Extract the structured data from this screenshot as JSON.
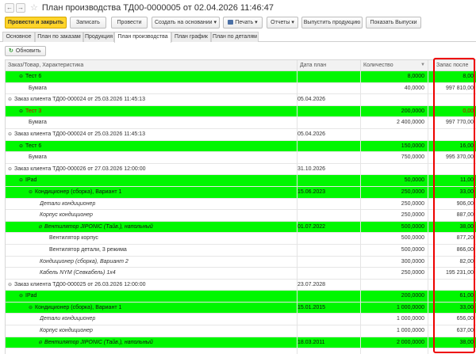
{
  "window": {
    "title": "План производства ТД00-0000005 от 02.04.2026 11:46:47",
    "back_glyph": "←",
    "forward_glyph": "→",
    "favorite_icon": "star-icon"
  },
  "toolbar": {
    "post_close": "Провести и закрыть",
    "save": "Записать",
    "post": "Провести",
    "create_based": "Создать на основании ▾",
    "print": "Печать ▾",
    "reports": "Отчеты ▾",
    "release_products": "Выпустить продукцию",
    "show_releases": "Показать Выпуски",
    "primary_color": "#ffd42a"
  },
  "tabs": [
    "Основное",
    "План по заказам",
    "Продукция",
    "План производства",
    "План график",
    "План по деталям"
  ],
  "active_tab": "План производства",
  "refresh_label": "Обновить",
  "columns": {
    "name": "Заказ/Товар, Характеристика",
    "date": "Дата план",
    "qty": "Количество",
    "stock": "Запас после"
  },
  "rows": [
    {
      "level": 1,
      "green": true,
      "toggle": "⊖",
      "name": "Тест 6",
      "date": "",
      "qty": "8,0000",
      "stock": "8,00"
    },
    {
      "level": 2,
      "green": false,
      "toggle": "",
      "name": "Бумага",
      "date": "",
      "qty": "40,0000",
      "stock": "997 810,00"
    },
    {
      "level": 0,
      "green": false,
      "toggle": "⊖",
      "name": "Заказ клиента ТД00-000024 от 25.03.2026 11:45:13",
      "date": "05.04.2026",
      "qty": "",
      "stock": ""
    },
    {
      "level": 1,
      "green": true,
      "toggle": "⊖",
      "name": "Тест 3",
      "name_red": true,
      "date": "",
      "qty": "200,0000",
      "stock": "0,00"
    },
    {
      "level": 2,
      "green": false,
      "toggle": "",
      "name": "Бумага",
      "date": "",
      "qty": "2 400,0000",
      "stock": "997 770,00"
    },
    {
      "level": 0,
      "green": false,
      "toggle": "⊖",
      "name": "Заказ клиента ТД00-000024 от 25.03.2026 11:45:13",
      "date": "05.04.2026",
      "qty": "",
      "stock": ""
    },
    {
      "level": 1,
      "green": true,
      "toggle": "⊖",
      "name": "Тест 6",
      "date": "",
      "qty": "150,0000",
      "stock": "16,00"
    },
    {
      "level": 2,
      "green": false,
      "toggle": "",
      "name": "Бумага",
      "date": "",
      "qty": "750,0000",
      "stock": "995 370,00"
    },
    {
      "level": 0,
      "green": false,
      "toggle": "⊖",
      "name": "Заказ клиента ТД00-000026 от 27.03.2026 12:00:00",
      "date": "31.10.2026",
      "qty": "",
      "stock": ""
    },
    {
      "level": 1,
      "green": true,
      "toggle": "⊖",
      "name": "IPad",
      "date": "",
      "qty": "50,0000",
      "stock": "11,00"
    },
    {
      "level": 2,
      "green": true,
      "toggle": "⊖",
      "name": "Кондиционер (сборка), Вариант 1",
      "date": "15.06.2023",
      "qty": "250,0000",
      "stock": "33,00"
    },
    {
      "level": 3,
      "green": false,
      "toggle": "",
      "name": "Детали кондиционер",
      "date": "",
      "qty": "250,0000",
      "stock": "906,00"
    },
    {
      "level": 3,
      "green": false,
      "toggle": "",
      "name": "Корпус кондиционер",
      "date": "",
      "qty": "250,0000",
      "stock": "887,00"
    },
    {
      "level": 4,
      "green": true,
      "toggle": "⊖",
      "name": "Вентилятор JIPONIC (Тайв.), напольный",
      "date": "01.07.2022",
      "qty": "500,0000",
      "stock": "38,00"
    },
    {
      "level": 5,
      "green": false,
      "toggle": "",
      "name": "Вентилятор корпус",
      "date": "",
      "qty": "500,0000",
      "stock": "877,20"
    },
    {
      "level": 5,
      "green": false,
      "toggle": "",
      "name": "Вентилятор детали, 3 режима",
      "date": "",
      "qty": "500,0000",
      "stock": "866,00"
    },
    {
      "level": 3,
      "green": false,
      "toggle": "",
      "name": "Кондиционер (сборка), Вариант 2",
      "date": "",
      "qty": "300,0000",
      "stock": "82,00"
    },
    {
      "level": 3,
      "green": false,
      "toggle": "",
      "name": "Кабель NYM (Севкабель) 1х4",
      "date": "",
      "qty": "250,0000",
      "stock": "195 231,00"
    },
    {
      "level": 0,
      "green": false,
      "toggle": "⊖",
      "name": "Заказ клиента ТД00-000025 от 26.03.2026 12:00:00",
      "date": "23.07.2028",
      "qty": "",
      "stock": ""
    },
    {
      "level": 1,
      "green": true,
      "toggle": "⊖",
      "name": "IPad",
      "date": "",
      "qty": "200,0000",
      "stock": "61,00"
    },
    {
      "level": 2,
      "green": true,
      "toggle": "⊖",
      "name": "Кондиционер (сборка), Вариант 1",
      "date": "15.01.2015",
      "qty": "1 000,0000",
      "stock": "33,00"
    },
    {
      "level": 3,
      "green": false,
      "toggle": "",
      "name": "Детали кондиционер",
      "date": "",
      "qty": "1 000,0000",
      "stock": "656,00"
    },
    {
      "level": 3,
      "green": false,
      "toggle": "",
      "name": "Корпус кондиционер",
      "date": "",
      "qty": "1 000,0000",
      "stock": "637,00"
    },
    {
      "level": 4,
      "green": true,
      "toggle": "⊖",
      "name": "Вентилятор JIPONIC (Тайв.), напольный",
      "date": "18.03.2011",
      "qty": "2 000,0000",
      "stock": "38,00"
    }
  ],
  "colors": {
    "row_green": "#00f700",
    "highlight_border": "#e00000",
    "red_text": "#cc0000"
  }
}
